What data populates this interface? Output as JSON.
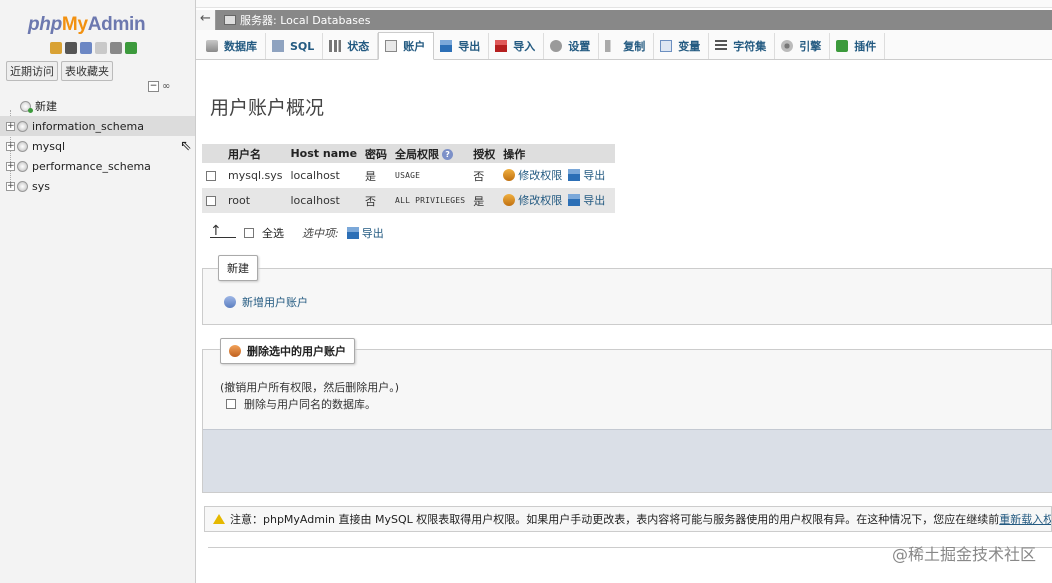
{
  "app": {
    "logo_php": "php",
    "logo_my": "My",
    "logo_admin": "Admin"
  },
  "nav": {
    "icons": [
      "home-icon",
      "exit-icon",
      "help-icon",
      "docs-icon",
      "settings-icon",
      "reload-icon"
    ],
    "buttons": {
      "recent": "近期访问",
      "favorites": "表收藏夹"
    },
    "collapse_symbol": "−",
    "link_symbol": "∞",
    "tree": [
      {
        "label": "新建",
        "type": "new"
      },
      {
        "label": "information_schema",
        "type": "db"
      },
      {
        "label": "mysql",
        "type": "db"
      },
      {
        "label": "performance_schema",
        "type": "db"
      },
      {
        "label": "sys",
        "type": "db"
      }
    ]
  },
  "breadcrumb": {
    "back_symbol": "←",
    "text": "服务器: Local Databases"
  },
  "menu": {
    "tabs": [
      {
        "label": "数据库",
        "icon": "database-icon"
      },
      {
        "label": "SQL",
        "icon": "sql-icon"
      },
      {
        "label": "状态",
        "icon": "status-icon"
      },
      {
        "label": "账户",
        "icon": "accounts-icon",
        "active": true
      },
      {
        "label": "导出",
        "icon": "export-icon"
      },
      {
        "label": "导入",
        "icon": "import-icon"
      },
      {
        "label": "设置",
        "icon": "settings-icon"
      },
      {
        "label": "复制",
        "icon": "replication-icon"
      },
      {
        "label": "变量",
        "icon": "variables-icon"
      },
      {
        "label": "字符集",
        "icon": "charset-icon"
      },
      {
        "label": "引擎",
        "icon": "engine-icon"
      },
      {
        "label": "插件",
        "icon": "plugin-icon"
      }
    ]
  },
  "page": {
    "title": "用户账户概况",
    "table": {
      "headers": {
        "user": "用户名",
        "host": "Host name",
        "password": "密码",
        "global_priv": "全局权限",
        "grant": "授权",
        "action": "操作"
      },
      "help_symbol": "?",
      "rows": [
        {
          "user": "mysql.sys",
          "host": "localhost",
          "password": "是",
          "priv": "USAGE",
          "grant": "否",
          "edit": "修改权限",
          "export": "导出",
          "password_red": false
        },
        {
          "user": "root",
          "host": "localhost",
          "password": "否",
          "priv": "ALL PRIVILEGES",
          "grant": "是",
          "edit": "修改权限",
          "export": "导出",
          "password_red": true
        }
      ]
    },
    "bulk": {
      "arrow": "↑",
      "select_all": "全选",
      "with_selected": "选中项:",
      "export": "导出"
    },
    "new_section": {
      "legend": "新建",
      "add_user": "新增用户账户"
    },
    "delete_section": {
      "legend": "删除选中的用户账户",
      "note": "(撤销用户所有权限，然后删除用户。)",
      "drop_db_label": "删除与用户同名的数据库。"
    },
    "notice": {
      "text": "注意：phpMyAdmin 直接由 MySQL 权限表取得用户权限。如果用户手动更改表，表内容将可能与服务器使用的用户权限有异。在这种情况下，您应在继续前",
      "link": "重新载入权限"
    },
    "watermark": "@稀土掘金技术社区"
  },
  "colors": {
    "link": "#235a81",
    "breadcrumb_bg": "#888888",
    "logo_orange": "#f29111",
    "logo_blue": "#6c78af"
  }
}
